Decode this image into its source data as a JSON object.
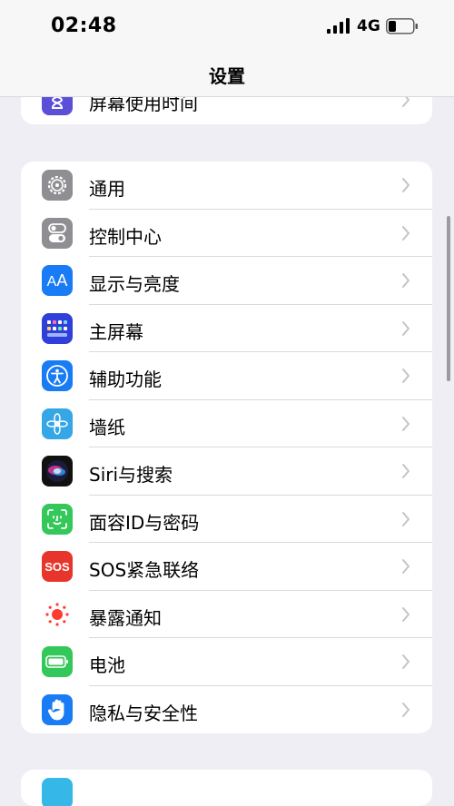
{
  "status_bar": {
    "time": "02:48",
    "network": "4G"
  },
  "nav": {
    "title": "设置"
  },
  "top_group": {
    "item_label": "屏幕使用时间"
  },
  "main_group": {
    "items": [
      {
        "label": "通用",
        "icon": "gear-icon",
        "color": "#8e8e93"
      },
      {
        "label": "控制中心",
        "icon": "toggle-icon",
        "color": "#8e8e93"
      },
      {
        "label": "显示与亮度",
        "icon": "text-size-icon",
        "color": "#1a7cf5"
      },
      {
        "label": "主屏幕",
        "icon": "grid-icon",
        "color": "#2f3fd9"
      },
      {
        "label": "辅助功能",
        "icon": "accessibility-icon",
        "color": "#1a7cf5"
      },
      {
        "label": "墙纸",
        "icon": "flower-icon",
        "color": "#35a7e6"
      },
      {
        "label": "Siri与搜索",
        "icon": "siri-icon",
        "color": "#111111"
      },
      {
        "label": "面容ID与密码",
        "icon": "face-id-icon",
        "color": "#34c759"
      },
      {
        "label": "SOS紧急联络",
        "icon": "sos-icon",
        "color": "#e8352b",
        "icon_text": "SOS"
      },
      {
        "label": "暴露通知",
        "icon": "exposure-icon",
        "color": "#ffffff"
      },
      {
        "label": "电池",
        "icon": "battery-icon",
        "color": "#34c759"
      },
      {
        "label": "隐私与安全性",
        "icon": "hand-icon",
        "color": "#1a7cf5"
      }
    ]
  }
}
